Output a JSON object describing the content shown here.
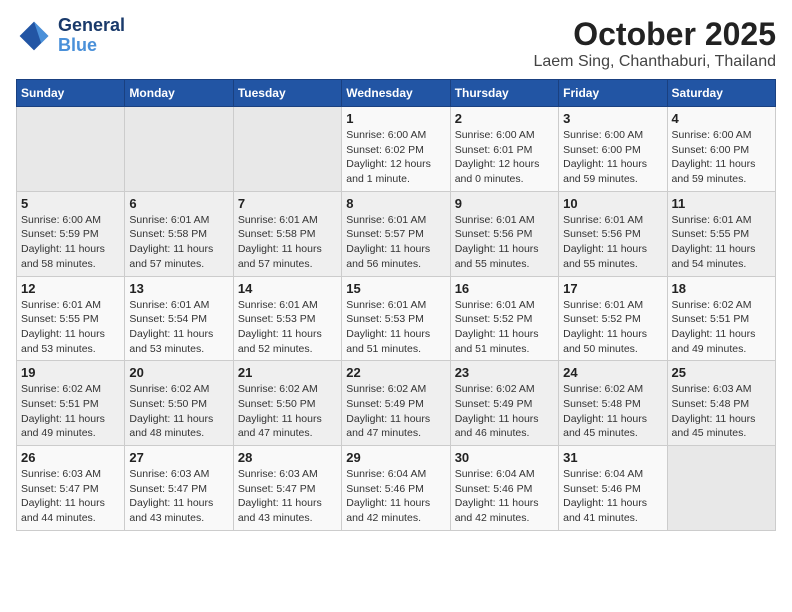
{
  "logo": {
    "line1": "General",
    "line2": "Blue"
  },
  "title": "October 2025",
  "location": "Laem Sing, Chanthaburi, Thailand",
  "weekdays": [
    "Sunday",
    "Monday",
    "Tuesday",
    "Wednesday",
    "Thursday",
    "Friday",
    "Saturday"
  ],
  "weeks": [
    [
      {
        "day": "",
        "info": ""
      },
      {
        "day": "",
        "info": ""
      },
      {
        "day": "",
        "info": ""
      },
      {
        "day": "1",
        "info": "Sunrise: 6:00 AM\nSunset: 6:02 PM\nDaylight: 12 hours\nand 1 minute."
      },
      {
        "day": "2",
        "info": "Sunrise: 6:00 AM\nSunset: 6:01 PM\nDaylight: 12 hours\nand 0 minutes."
      },
      {
        "day": "3",
        "info": "Sunrise: 6:00 AM\nSunset: 6:00 PM\nDaylight: 11 hours\nand 59 minutes."
      },
      {
        "day": "4",
        "info": "Sunrise: 6:00 AM\nSunset: 6:00 PM\nDaylight: 11 hours\nand 59 minutes."
      }
    ],
    [
      {
        "day": "5",
        "info": "Sunrise: 6:00 AM\nSunset: 5:59 PM\nDaylight: 11 hours\nand 58 minutes."
      },
      {
        "day": "6",
        "info": "Sunrise: 6:01 AM\nSunset: 5:58 PM\nDaylight: 11 hours\nand 57 minutes."
      },
      {
        "day": "7",
        "info": "Sunrise: 6:01 AM\nSunset: 5:58 PM\nDaylight: 11 hours\nand 57 minutes."
      },
      {
        "day": "8",
        "info": "Sunrise: 6:01 AM\nSunset: 5:57 PM\nDaylight: 11 hours\nand 56 minutes."
      },
      {
        "day": "9",
        "info": "Sunrise: 6:01 AM\nSunset: 5:56 PM\nDaylight: 11 hours\nand 55 minutes."
      },
      {
        "day": "10",
        "info": "Sunrise: 6:01 AM\nSunset: 5:56 PM\nDaylight: 11 hours\nand 55 minutes."
      },
      {
        "day": "11",
        "info": "Sunrise: 6:01 AM\nSunset: 5:55 PM\nDaylight: 11 hours\nand 54 minutes."
      }
    ],
    [
      {
        "day": "12",
        "info": "Sunrise: 6:01 AM\nSunset: 5:55 PM\nDaylight: 11 hours\nand 53 minutes."
      },
      {
        "day": "13",
        "info": "Sunrise: 6:01 AM\nSunset: 5:54 PM\nDaylight: 11 hours\nand 53 minutes."
      },
      {
        "day": "14",
        "info": "Sunrise: 6:01 AM\nSunset: 5:53 PM\nDaylight: 11 hours\nand 52 minutes."
      },
      {
        "day": "15",
        "info": "Sunrise: 6:01 AM\nSunset: 5:53 PM\nDaylight: 11 hours\nand 51 minutes."
      },
      {
        "day": "16",
        "info": "Sunrise: 6:01 AM\nSunset: 5:52 PM\nDaylight: 11 hours\nand 51 minutes."
      },
      {
        "day": "17",
        "info": "Sunrise: 6:01 AM\nSunset: 5:52 PM\nDaylight: 11 hours\nand 50 minutes."
      },
      {
        "day": "18",
        "info": "Sunrise: 6:02 AM\nSunset: 5:51 PM\nDaylight: 11 hours\nand 49 minutes."
      }
    ],
    [
      {
        "day": "19",
        "info": "Sunrise: 6:02 AM\nSunset: 5:51 PM\nDaylight: 11 hours\nand 49 minutes."
      },
      {
        "day": "20",
        "info": "Sunrise: 6:02 AM\nSunset: 5:50 PM\nDaylight: 11 hours\nand 48 minutes."
      },
      {
        "day": "21",
        "info": "Sunrise: 6:02 AM\nSunset: 5:50 PM\nDaylight: 11 hours\nand 47 minutes."
      },
      {
        "day": "22",
        "info": "Sunrise: 6:02 AM\nSunset: 5:49 PM\nDaylight: 11 hours\nand 47 minutes."
      },
      {
        "day": "23",
        "info": "Sunrise: 6:02 AM\nSunset: 5:49 PM\nDaylight: 11 hours\nand 46 minutes."
      },
      {
        "day": "24",
        "info": "Sunrise: 6:02 AM\nSunset: 5:48 PM\nDaylight: 11 hours\nand 45 minutes."
      },
      {
        "day": "25",
        "info": "Sunrise: 6:03 AM\nSunset: 5:48 PM\nDaylight: 11 hours\nand 45 minutes."
      }
    ],
    [
      {
        "day": "26",
        "info": "Sunrise: 6:03 AM\nSunset: 5:47 PM\nDaylight: 11 hours\nand 44 minutes."
      },
      {
        "day": "27",
        "info": "Sunrise: 6:03 AM\nSunset: 5:47 PM\nDaylight: 11 hours\nand 43 minutes."
      },
      {
        "day": "28",
        "info": "Sunrise: 6:03 AM\nSunset: 5:47 PM\nDaylight: 11 hours\nand 43 minutes."
      },
      {
        "day": "29",
        "info": "Sunrise: 6:04 AM\nSunset: 5:46 PM\nDaylight: 11 hours\nand 42 minutes."
      },
      {
        "day": "30",
        "info": "Sunrise: 6:04 AM\nSunset: 5:46 PM\nDaylight: 11 hours\nand 42 minutes."
      },
      {
        "day": "31",
        "info": "Sunrise: 6:04 AM\nSunset: 5:46 PM\nDaylight: 11 hours\nand 41 minutes."
      },
      {
        "day": "",
        "info": ""
      }
    ]
  ]
}
